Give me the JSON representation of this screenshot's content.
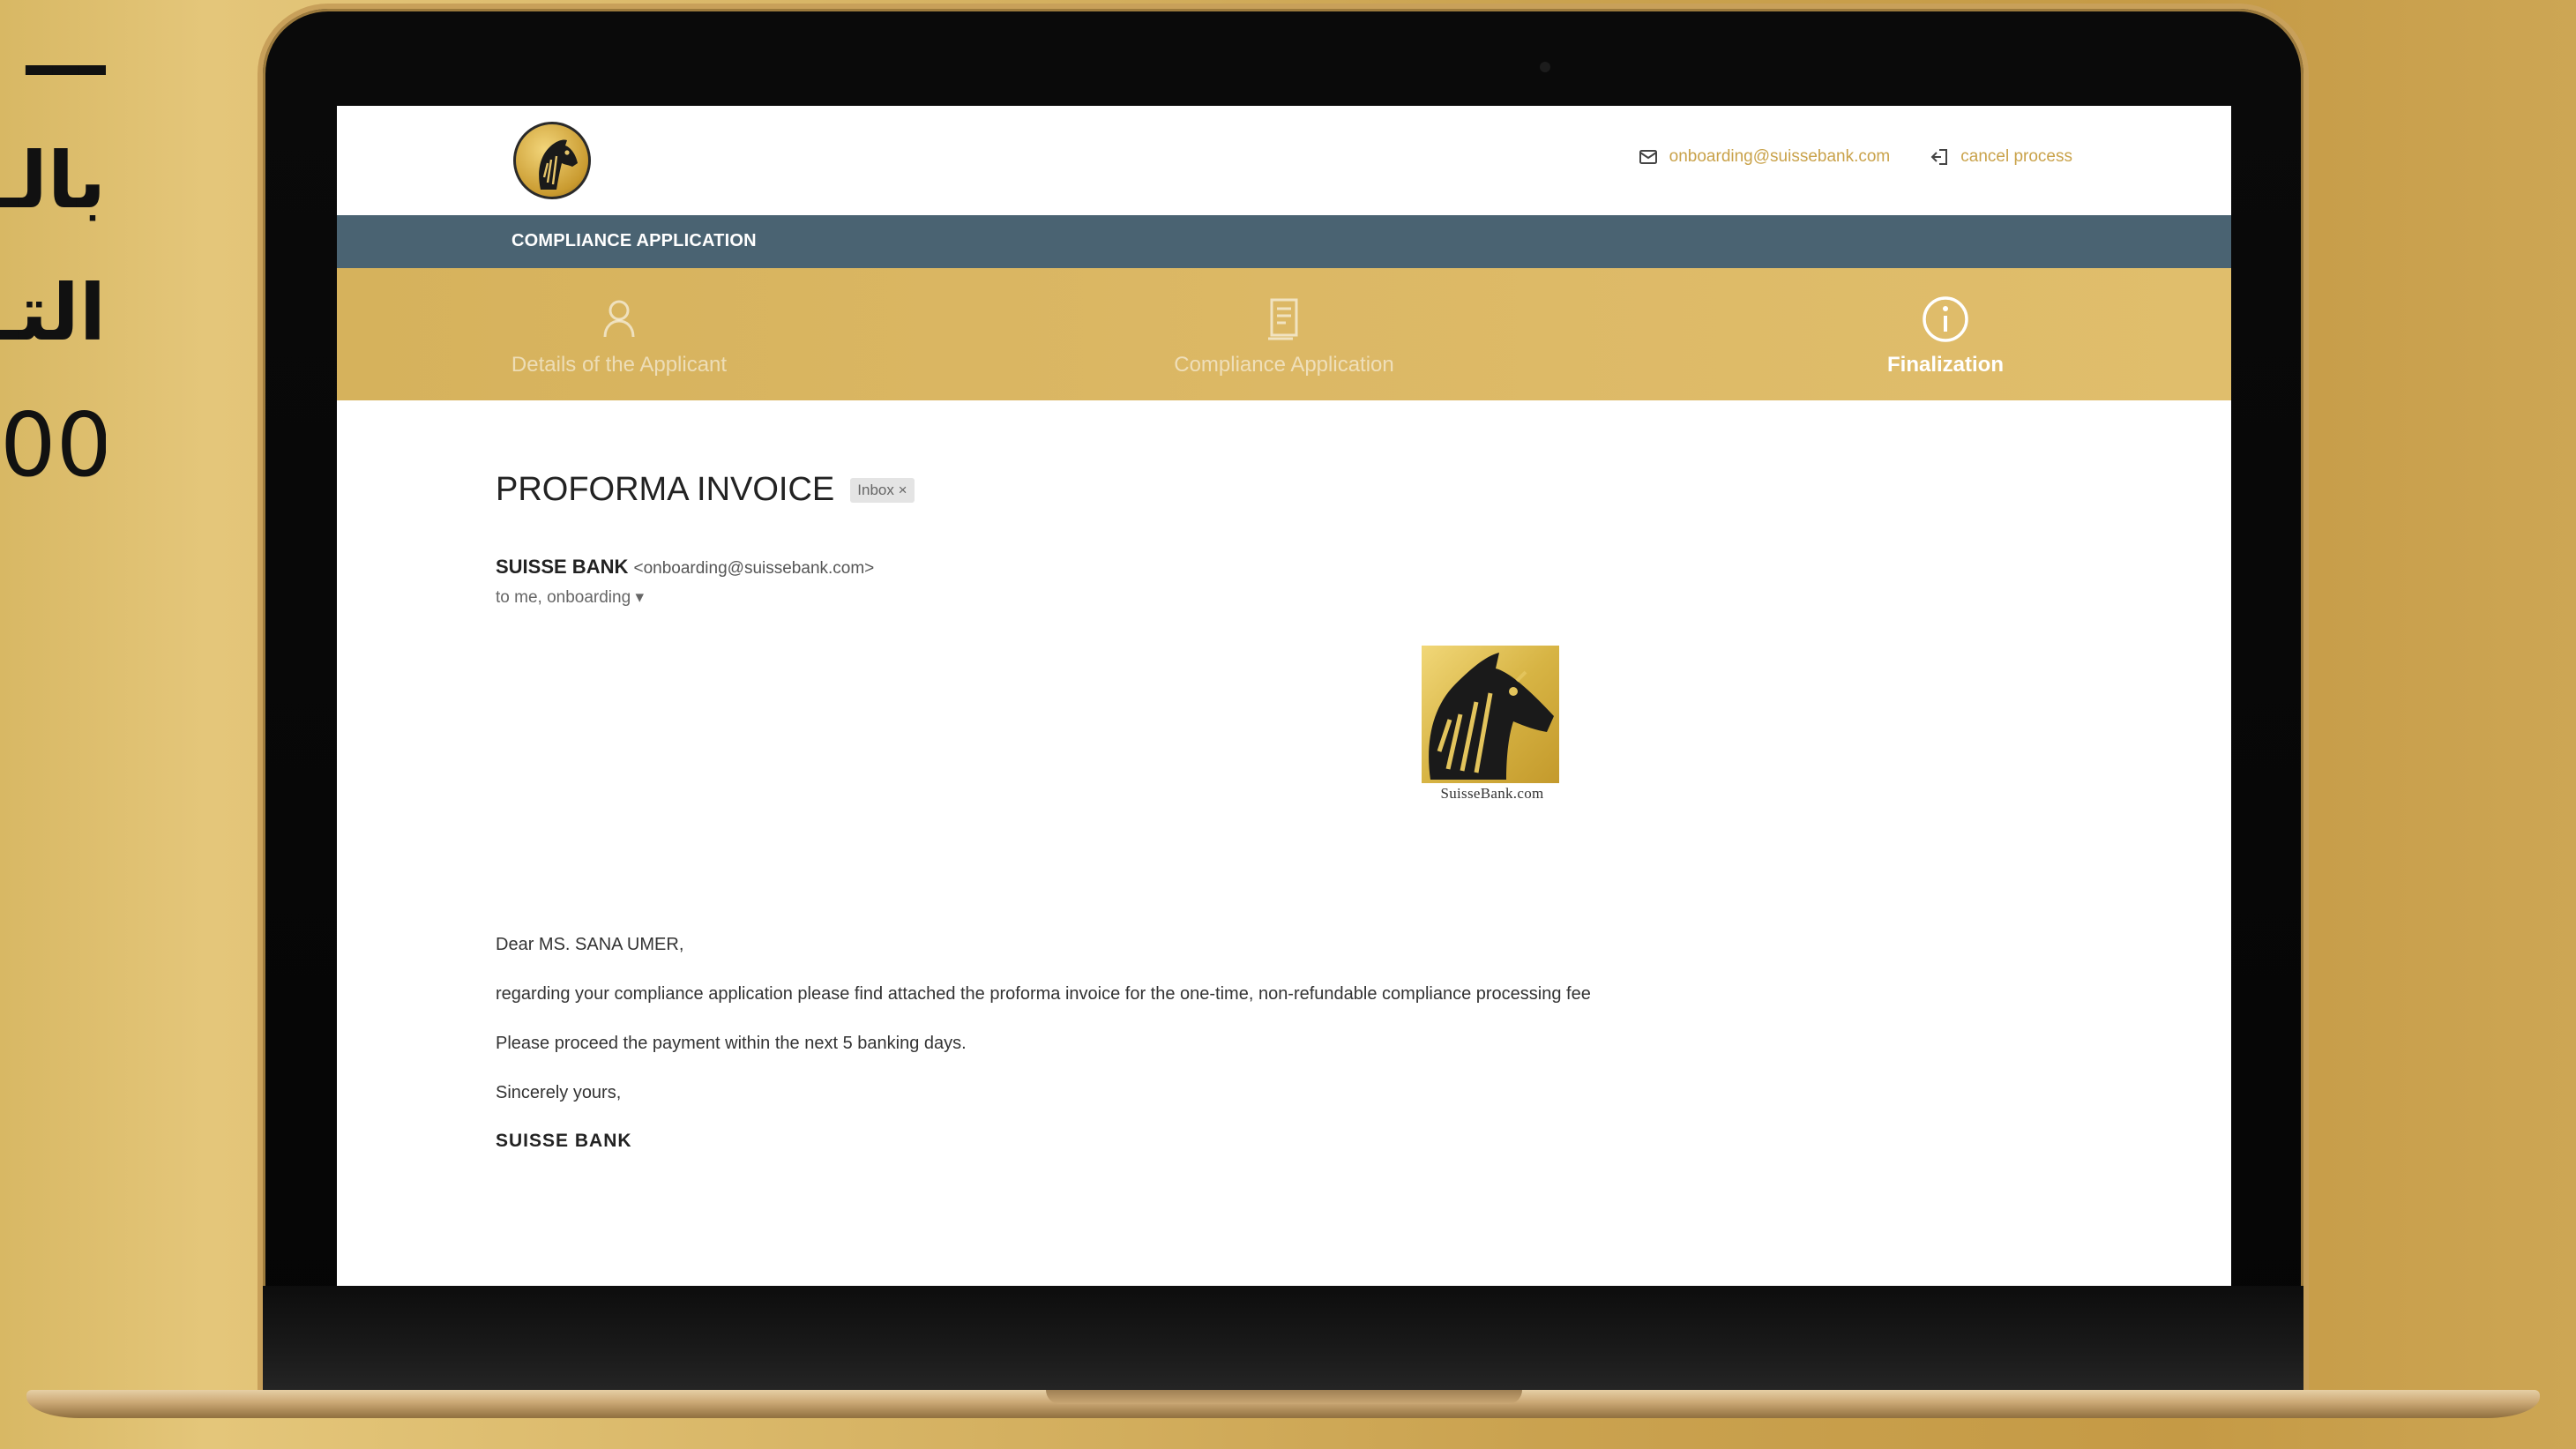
{
  "side_text": {
    "line1": "ـــ",
    "line2": "بالـ",
    "line3": "التـ",
    "line4": "00"
  },
  "header": {
    "email": "onboarding@suissebank.com",
    "cancel_label": "cancel process",
    "email_icon": "envelope-icon",
    "cancel_icon": "exit-icon"
  },
  "navbar": {
    "title": "COMPLIANCE APPLICATION"
  },
  "steps": [
    {
      "label": "Details of the Applicant",
      "icon": "user-icon",
      "active": false
    },
    {
      "label": "Compliance Application",
      "icon": "document-icon",
      "active": false
    },
    {
      "label": "Finalization",
      "icon": "info-icon",
      "active": true
    }
  ],
  "mail": {
    "subject": "PROFORMA INVOICE",
    "label_chip": "Inbox ×",
    "sender_name": "SUISSE BANK",
    "sender_address": "<onboarding@suissebank.com>",
    "recipients": "to me, onboarding ▾",
    "logo_caption": "SuisseBank.com",
    "greeting": "Dear MS. SANA UMER,",
    "line1": "regarding your compliance application please find attached the proforma invoice for the one-time, non-refundable compliance processing fee",
    "line2": "Please proceed the payment within the next 5 banking days.",
    "closing": "Sincerely yours,",
    "signature": "SUISSE BANK"
  },
  "colors": {
    "gold": "#d6b25c",
    "navbar": "#4a6372",
    "link": "#c9a24a"
  }
}
